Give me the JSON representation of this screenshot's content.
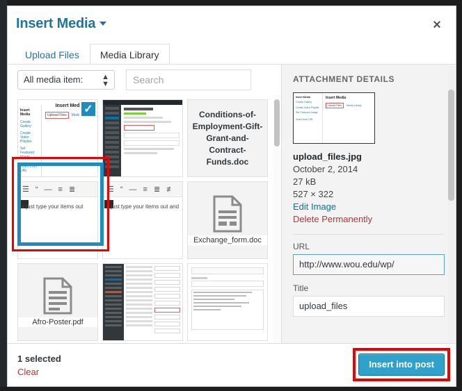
{
  "window": {
    "title": "Insert Media",
    "close_label": "×"
  },
  "tabs": [
    {
      "label": "Upload Files",
      "active": false
    },
    {
      "label": "Media Library",
      "active": true
    }
  ],
  "toolbar": {
    "filter_value": "All media item:",
    "search_placeholder": "Search",
    "search_value": ""
  },
  "grid": {
    "items": [
      {
        "name": "upload_files.jpg",
        "kind": "screenshot-insert-media",
        "selected": true,
        "annotated": true
      },
      {
        "name": "edit-post-screenshot",
        "kind": "screenshot-edit-post",
        "selected": false
      },
      {
        "name": "Conditions-of-Employment-Gift-Grant-and-Contract-Funds.doc",
        "kind": "doc-text",
        "label": "Conditions-of-Employment-Gift-Grant-and-Contract-Funds.doc"
      },
      {
        "name": "editor-toolbar-a",
        "kind": "editor",
        "text": "s just type your items out"
      },
      {
        "name": "editor-toolbar-b",
        "kind": "editor",
        "text": "s just type your items out and"
      },
      {
        "name": "Exchange_form.doc",
        "kind": "doc-icon",
        "label": "Exchange_form.doc"
      },
      {
        "name": "Afro-Poster.pdf",
        "kind": "doc-icon",
        "label": "Afro-Poster.pdf"
      },
      {
        "name": "wp-settings-screenshot",
        "kind": "wp-settings"
      },
      {
        "name": "text-widget-screenshot",
        "kind": "widget"
      }
    ]
  },
  "details": {
    "heading": "ATTACHMENT DETAILS",
    "preview": {
      "sidebar_items": [
        "Insert Media",
        "Create Gallery",
        "Create Video Playlist",
        "Set Featured Image",
        "Insert from URL"
      ],
      "main_title": "Insert Media",
      "tab_boxed": "Upload Files",
      "tab_plain": "Media Library"
    },
    "filename": "upload_files.jpg",
    "date": "October 2, 2014",
    "filesize": "27 kB",
    "dimensions": "527 × 322",
    "edit_image_label": "Edit Image",
    "delete_label": "Delete Permanently",
    "url_label": "URL",
    "url_value": "http://www.wou.edu/wp/",
    "title_label": "Title",
    "title_value": "upload_files"
  },
  "footer": {
    "selected_count": "1 selected",
    "clear_label": "Clear",
    "insert_label": "Insert into post"
  },
  "colors": {
    "accent_blue": "#2ea2cc",
    "link_blue": "#0073aa",
    "title_blue": "#21759b",
    "annotation_red": "#ee0000",
    "danger_red": "#bb3333",
    "selection_blue": "#1e8cbe"
  }
}
